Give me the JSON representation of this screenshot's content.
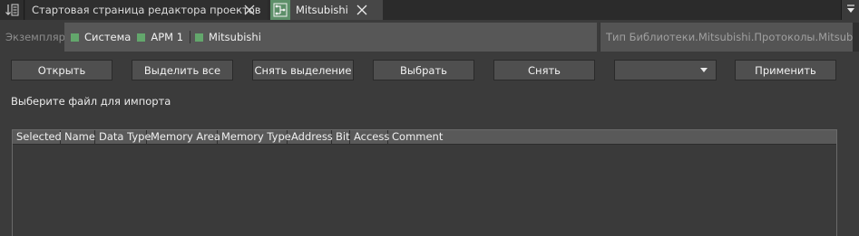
{
  "tabs": [
    {
      "label": "Стартовая страница редактора проектов",
      "active": false
    },
    {
      "label": "Mitsubishi",
      "active": true
    }
  ],
  "breadcrumb": {
    "caption": "Экземпляр",
    "items": [
      "Система",
      "АРМ 1",
      "Mitsubishi"
    ],
    "type_path": "Тип Библиотеки.Mitsubishi.Протоколы.Mitsubishi"
  },
  "toolbar": {
    "open": "Открыть",
    "select_all": "Выделить все",
    "deselect": "Снять выделение",
    "choose": "Выбрать",
    "remove": "Снять",
    "dropdown_value": "",
    "apply": "Применить"
  },
  "hint": "Выберите файл для импорта",
  "table": {
    "columns": [
      "Selected",
      "Name",
      "Data Type",
      "Memory Area",
      "Memory Type",
      "Address",
      "Bit",
      "Access",
      "Comment"
    ],
    "rows": []
  },
  "colors": {
    "background": "#3b3b3b",
    "node_square": "#63a76c",
    "active_tab_icon": "#5d8f69"
  }
}
